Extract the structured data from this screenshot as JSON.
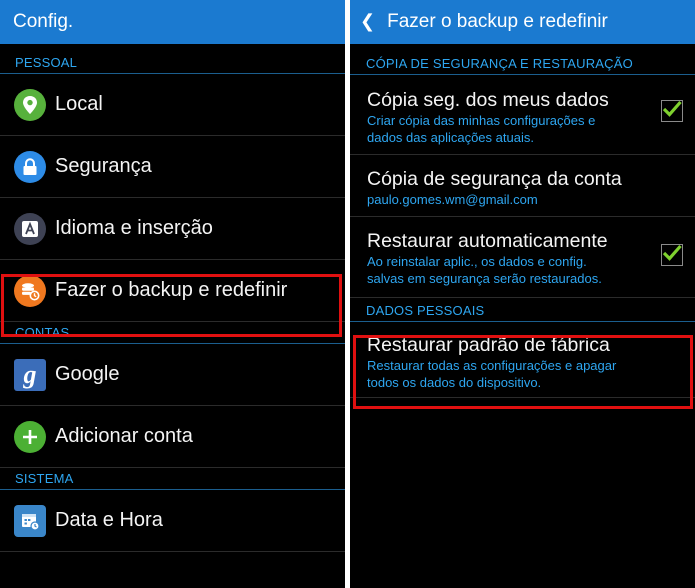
{
  "left": {
    "header": {
      "title": "Config."
    },
    "sections": {
      "pessoal": "PESSOAL",
      "contas": "CONTAS",
      "sistema": "SISTEMA"
    },
    "items": {
      "local": "Local",
      "seguranca": "Segurança",
      "idioma": "Idioma e inserção",
      "backup": "Fazer o backup e redefinir",
      "google": "Google",
      "adicionar": "Adicionar conta",
      "datahora": "Data e Hora"
    }
  },
  "right": {
    "header": {
      "title": "Fazer o backup e redefinir"
    },
    "sections": {
      "copia": "CÓPIA DE SEGURANÇA E RESTAURAÇÃO",
      "dados": "DADOS PESSOAIS"
    },
    "settings": {
      "copia_dados": {
        "title": "Cópia seg. dos meus dados",
        "summary_1": "Criar cópia das minhas configurações e",
        "summary_2": "dados das aplicações atuais.",
        "checked": true
      },
      "copia_conta": {
        "title": "Cópia de segurança da conta",
        "summary": "paulo.gomes.wm@gmail.com"
      },
      "restaurar_auto": {
        "title": "Restaurar automaticamente",
        "summary_1": "Ao reinstalar aplic., os dados e config.",
        "summary_2": "salvas em segurança serão restaurados.",
        "checked": true
      },
      "padrao_fabrica": {
        "title": "Restaurar padrão de fábrica",
        "summary_1": "Restaurar todas as configurações e apagar",
        "summary_2": "todos os dados do dispositivo."
      }
    }
  },
  "colors": {
    "actionbar": "#1b7ad0",
    "section_header": "#2ea6f0",
    "highlight": "#e01010",
    "check": "#7fd12f"
  }
}
